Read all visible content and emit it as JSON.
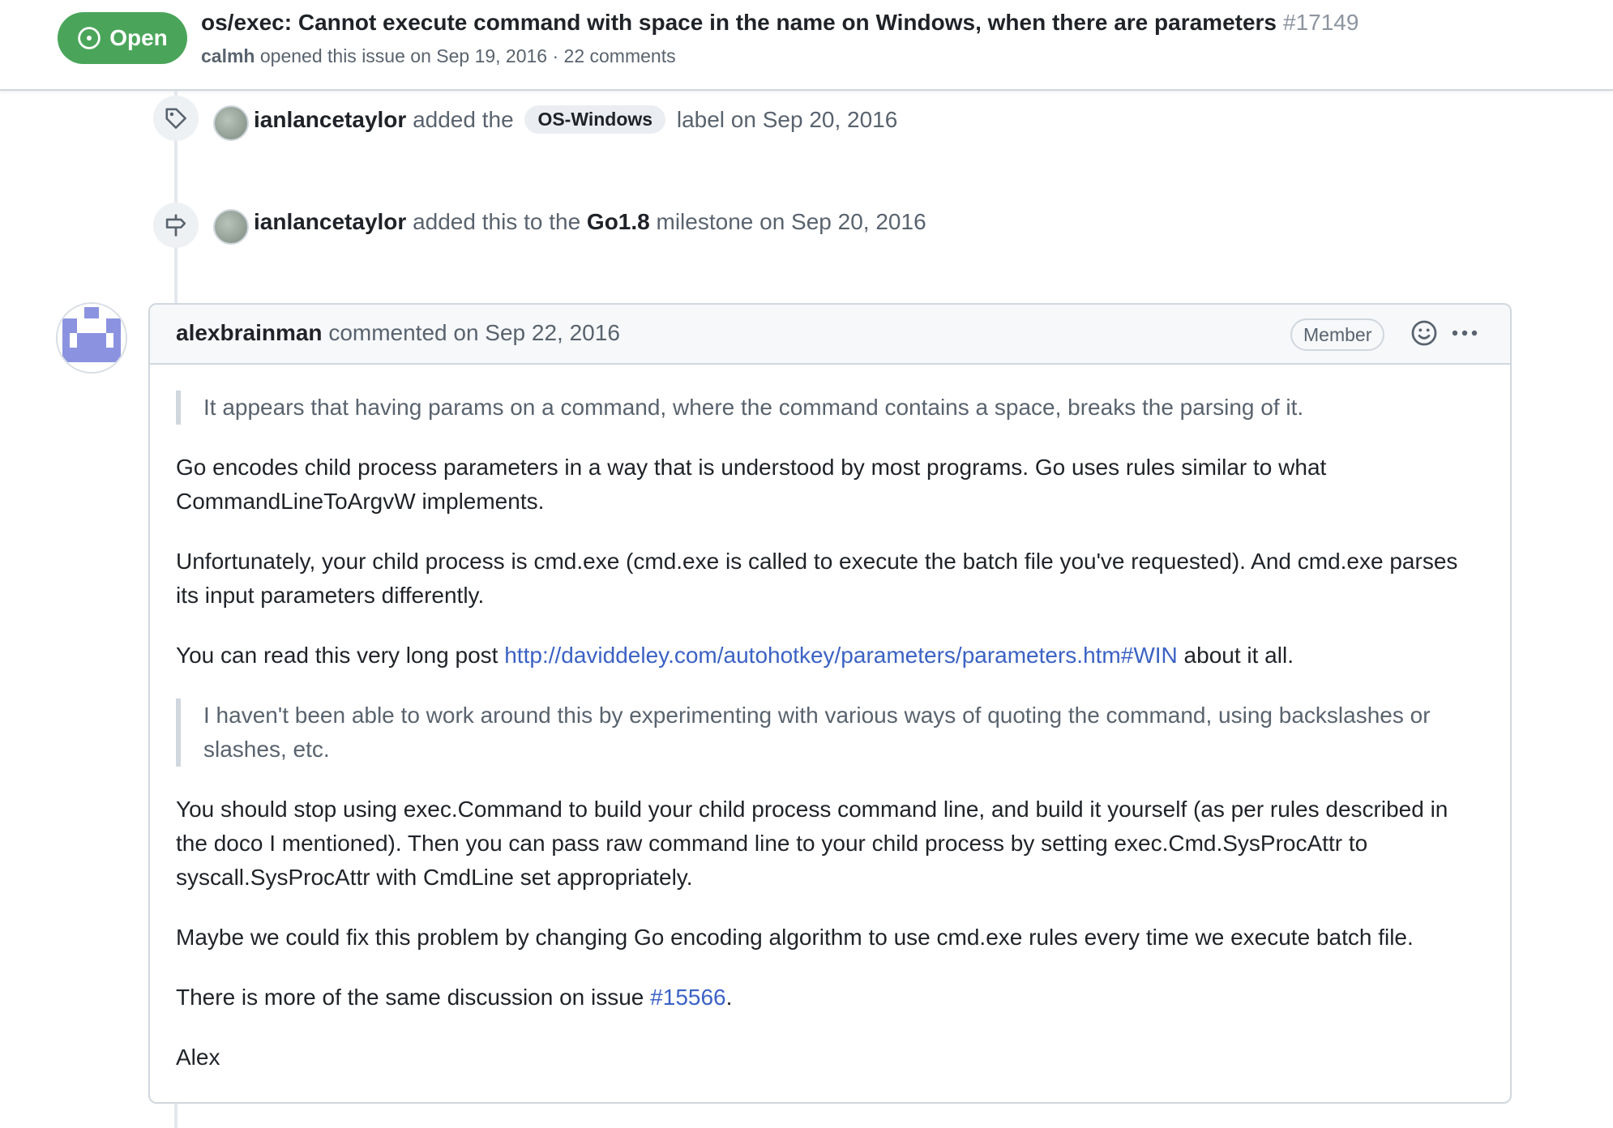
{
  "header": {
    "state_label": "Open",
    "title": "os/exec: Cannot execute command with space in the name on Windows, when there are parameters",
    "number": "#17149",
    "author": "calmh",
    "opened_text": "opened this issue on Sep 19, 2016 · 22 comments"
  },
  "events": [
    {
      "icon": "tag-icon",
      "actor": "ianlancetaylor",
      "prefix": "added the",
      "label": "OS-Windows",
      "suffix": "label on Sep 20, 2016"
    },
    {
      "icon": "milestone-icon",
      "actor": "ianlancetaylor",
      "prefix": "added this to the",
      "milestone": "Go1.8",
      "suffix": "milestone on Sep 20, 2016"
    }
  ],
  "comment": {
    "author": "alexbrainman",
    "meta": "commented on Sep 22, 2016",
    "role_badge": "Member",
    "quote1": "It appears that having params on a command, where the command contains a space, breaks the parsing of it.",
    "p1": "Go encodes child process parameters in a way that is understood by most programs. Go uses rules similar to what CommandLineToArgvW implements.",
    "p2": "Unfortunately, your child process is cmd.exe (cmd.exe is called to execute the batch file you've requested). And cmd.exe parses its input parameters differently.",
    "p3_prefix": "You can read this very long post",
    "p3_link": "http://daviddeley.com/autohotkey/parameters/parameters.htm#WIN",
    "p3_suffix": "about it all.",
    "quote2": "I haven't been able to work around this by experimenting with various ways of quoting the command, using backslashes or slashes, etc.",
    "p4": "You should stop using exec.Command to build your child process command line, and build it yourself (as per rules described in the doco I mentioned). Then you can pass raw command line to your child process by setting exec.Cmd.SysProcAttr to syscall.SysProcAttr with CmdLine set appropriately.",
    "p5": "Maybe we could fix this problem by changing Go encoding algorithm to use cmd.exe rules every time we execute batch file.",
    "p6_prefix": "There is more of the same discussion on issue",
    "p6_link": "#15566",
    "p6_suffix": ".",
    "signature": "Alex"
  },
  "colors": {
    "open_green": "#4aa55a",
    "link_blue": "#3b62c4",
    "muted_text": "#59636e",
    "border": "#d0d7de",
    "avatar_identicon": "#8b93e0"
  }
}
